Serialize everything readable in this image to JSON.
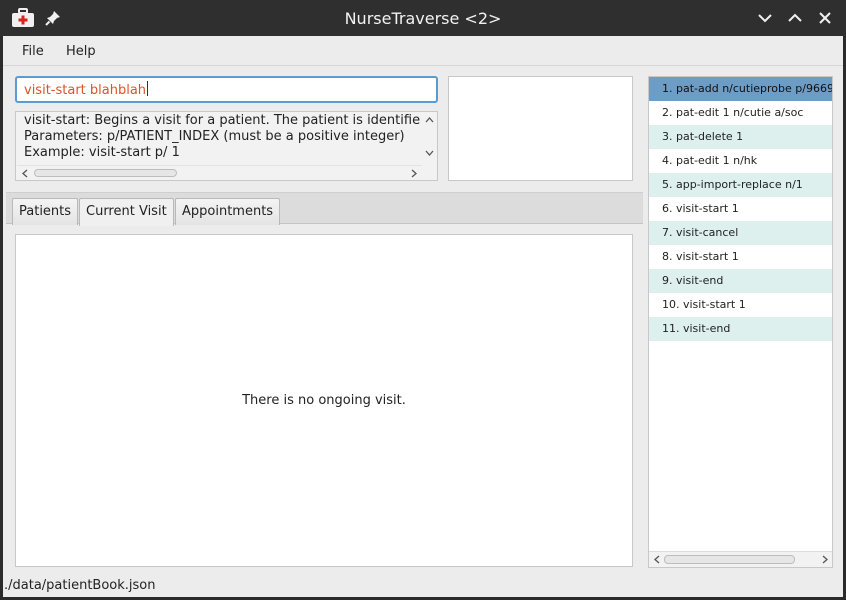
{
  "window": {
    "title": "NurseTraverse <2>"
  },
  "menu": {
    "file": "File",
    "help": "Help"
  },
  "command_box": {
    "value": "visit-start blahblah"
  },
  "result_display": {
    "lines": [
      "visit-start: Begins a visit for a patient. The patient is identifie",
      "Parameters: p/PATIENT_INDEX (must be a positive integer)",
      "Example: visit-start p/ 1"
    ]
  },
  "tabs": [
    {
      "label": "Patients"
    },
    {
      "label": "Current Visit"
    },
    {
      "label": "Appointments"
    }
  ],
  "current_visit": {
    "message": "There is no ongoing visit."
  },
  "history": {
    "items": [
      "1. pat-add n/cutieprobe p/9669",
      "2. pat-edit 1 n/cutie a/soc",
      "3. pat-delete 1",
      "4. pat-edit 1    n/hk",
      "5. app-import-replace n/1",
      "6. visit-start 1",
      "7. visit-cancel",
      "8. visit-start 1",
      "9. visit-end",
      "10. visit-start 1",
      "11. visit-end"
    ]
  },
  "status_bar": {
    "path": "./data/patientBook.json"
  },
  "colors": {
    "command_text": "#d9532a",
    "input_focus_border": "#5b9bd5",
    "history_selected": "#6d9cc5",
    "history_alt_row": "#ddf0ee"
  },
  "icons": [
    "medical-kit-icon",
    "pin-icon",
    "minimize-icon",
    "maximize-icon",
    "close-icon"
  ]
}
